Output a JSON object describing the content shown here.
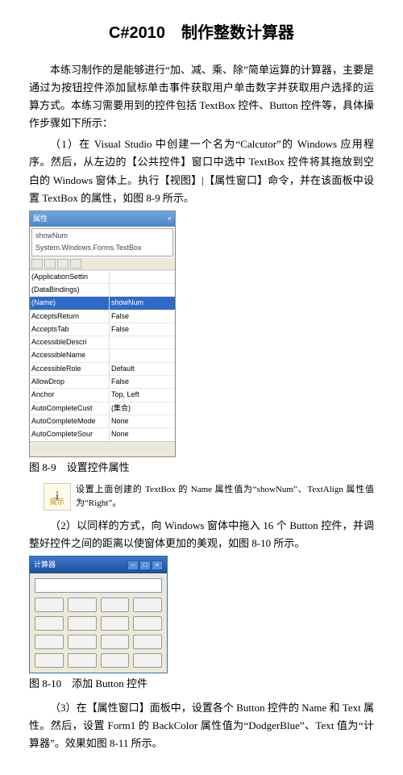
{
  "title": "C#2010　制作整数计算器",
  "p1": "本练习制作的是能够进行“加、减、乘、除”简单运算的计算器，主要是通过为按钮控件添加鼠标单击事件获取用户单击数字并获取用户选择的运算方式。本练习需要用到的控件包括 TextBox 控件、Button 控件等，具体操作步骤如下所示：",
  "p2": "（1）在 Visual Studio 中创建一个名为“Calcutor”的 Windows 应用程序。然后，从左边的【公共控件】窗口中选中 TextBox 控件将其拖放到空白的 Windows 窗体上。执行【视图】|【属性窗口】命令，并在该面板中设置 TextBox 的属性，如图 8-9 所示。",
  "fig89": {
    "panelName": "属性",
    "dropdown": "showNum System.Windows.Forms.TextBox",
    "rows": [
      {
        "k": "(ApplicationSettin",
        "v": ""
      },
      {
        "k": "(DataBindings)",
        "v": ""
      },
      {
        "k": "(Name)",
        "v": "showNum",
        "hl": true
      },
      {
        "k": "AcceptsReturn",
        "v": "False"
      },
      {
        "k": "AcceptsTab",
        "v": "False"
      },
      {
        "k": "AccessibleDescri",
        "v": ""
      },
      {
        "k": "AccessibleName",
        "v": ""
      },
      {
        "k": "AccessibleRole",
        "v": "Default"
      },
      {
        "k": "AllowDrop",
        "v": "False"
      },
      {
        "k": "Anchor",
        "v": "Top, Left"
      },
      {
        "k": "AutoCompleteCust",
        "v": "(集合)"
      },
      {
        "k": "AutoCompleteMode",
        "v": "None"
      },
      {
        "k": "AutoCompleteSour",
        "v": "None"
      }
    ],
    "caption": "图 8-9　设置控件属性"
  },
  "tip": {
    "label": "提示",
    "text": "设置上面创建的 TextBox 的 Name 属性值为“showNum”、TextAlign 属性值为“Right”。"
  },
  "p3": "（2）以同样的方式，向 Windows 窗体中拖入 16 个 Button 控件，并调整好控件之间的距离以使窗体更加的美观，如图 8-10 所示。",
  "fig810": {
    "formTitle": "计算器",
    "caption": "图 8-10　添加 Button 控件"
  },
  "p4": "（3）在【属性窗口】面板中，设置各个 Button 控件的 Name 和 Text 属性。然后，设置 Form1 的 BackColor 属性值为“DodgerBlue”、Text 值为“计算器”。效果如图 8-11 所示。"
}
